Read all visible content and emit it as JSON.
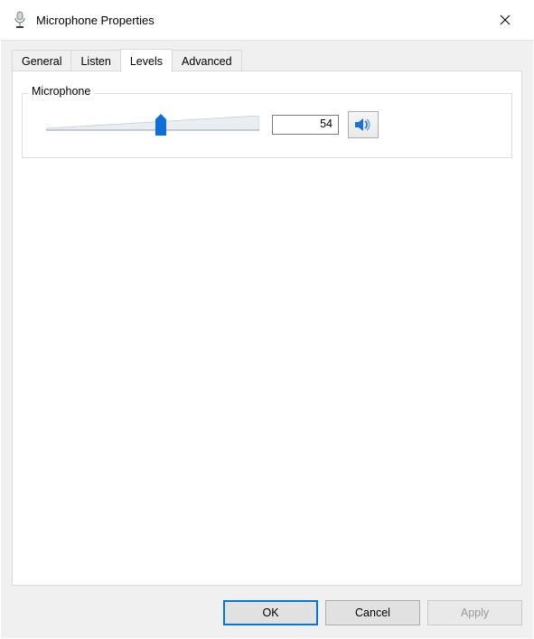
{
  "window": {
    "title": "Microphone Properties"
  },
  "tabs": {
    "general": "General",
    "listen": "Listen",
    "levels": "Levels",
    "advanced": "Advanced"
  },
  "group": {
    "legend": "Microphone"
  },
  "level": {
    "value": "54",
    "percent": 54
  },
  "buttons": {
    "ok": "OK",
    "cancel": "Cancel",
    "apply": "Apply"
  }
}
